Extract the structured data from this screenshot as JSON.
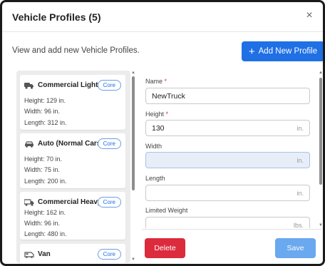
{
  "dialog": {
    "title": "Vehicle Profiles (5)",
    "close_glyph": "×"
  },
  "intro": {
    "text": "View and add new Vehicle Profiles.",
    "add_button_label": "Add New Profile",
    "add_button_glyph": "+"
  },
  "profiles": [
    {
      "name": "Commercial Light",
      "badge": "Core",
      "icon": "truck-icon",
      "height": "Height: 129 in.",
      "width": "Width: 96 in.",
      "length": "Length: 312 in."
    },
    {
      "name": "Auto (Normal Cars)",
      "badge": "Core",
      "icon": "car-icon",
      "height": "Height: 70 in.",
      "width": "Width: 75 in.",
      "length": "Length: 200 in."
    },
    {
      "name": "Commercial Heavy",
      "badge": "Core",
      "icon": "heavy-truck-icon",
      "height": "Height: 162 in.",
      "width": "Width: 96 in.",
      "length": "Length: 480 in."
    },
    {
      "name": "Van",
      "badge": "Core",
      "icon": "van-icon"
    }
  ],
  "form": {
    "name": {
      "label": "Name",
      "required": "*",
      "value": "NewTruck"
    },
    "height": {
      "label": "Height",
      "required": "*",
      "value": "130",
      "unit": "in."
    },
    "width": {
      "label": "Width",
      "value": "",
      "unit": "in."
    },
    "length": {
      "label": "Length",
      "value": "",
      "unit": "in."
    },
    "limited_weight": {
      "label": "Limited Weight",
      "value": "",
      "unit": "lbs."
    }
  },
  "footer": {
    "delete_label": "Delete",
    "save_label": "Save"
  },
  "colors": {
    "primary": "#1f6fe5",
    "danger": "#dc2b3c",
    "save_disabled": "#6aa8f0",
    "required": "#d33333"
  }
}
